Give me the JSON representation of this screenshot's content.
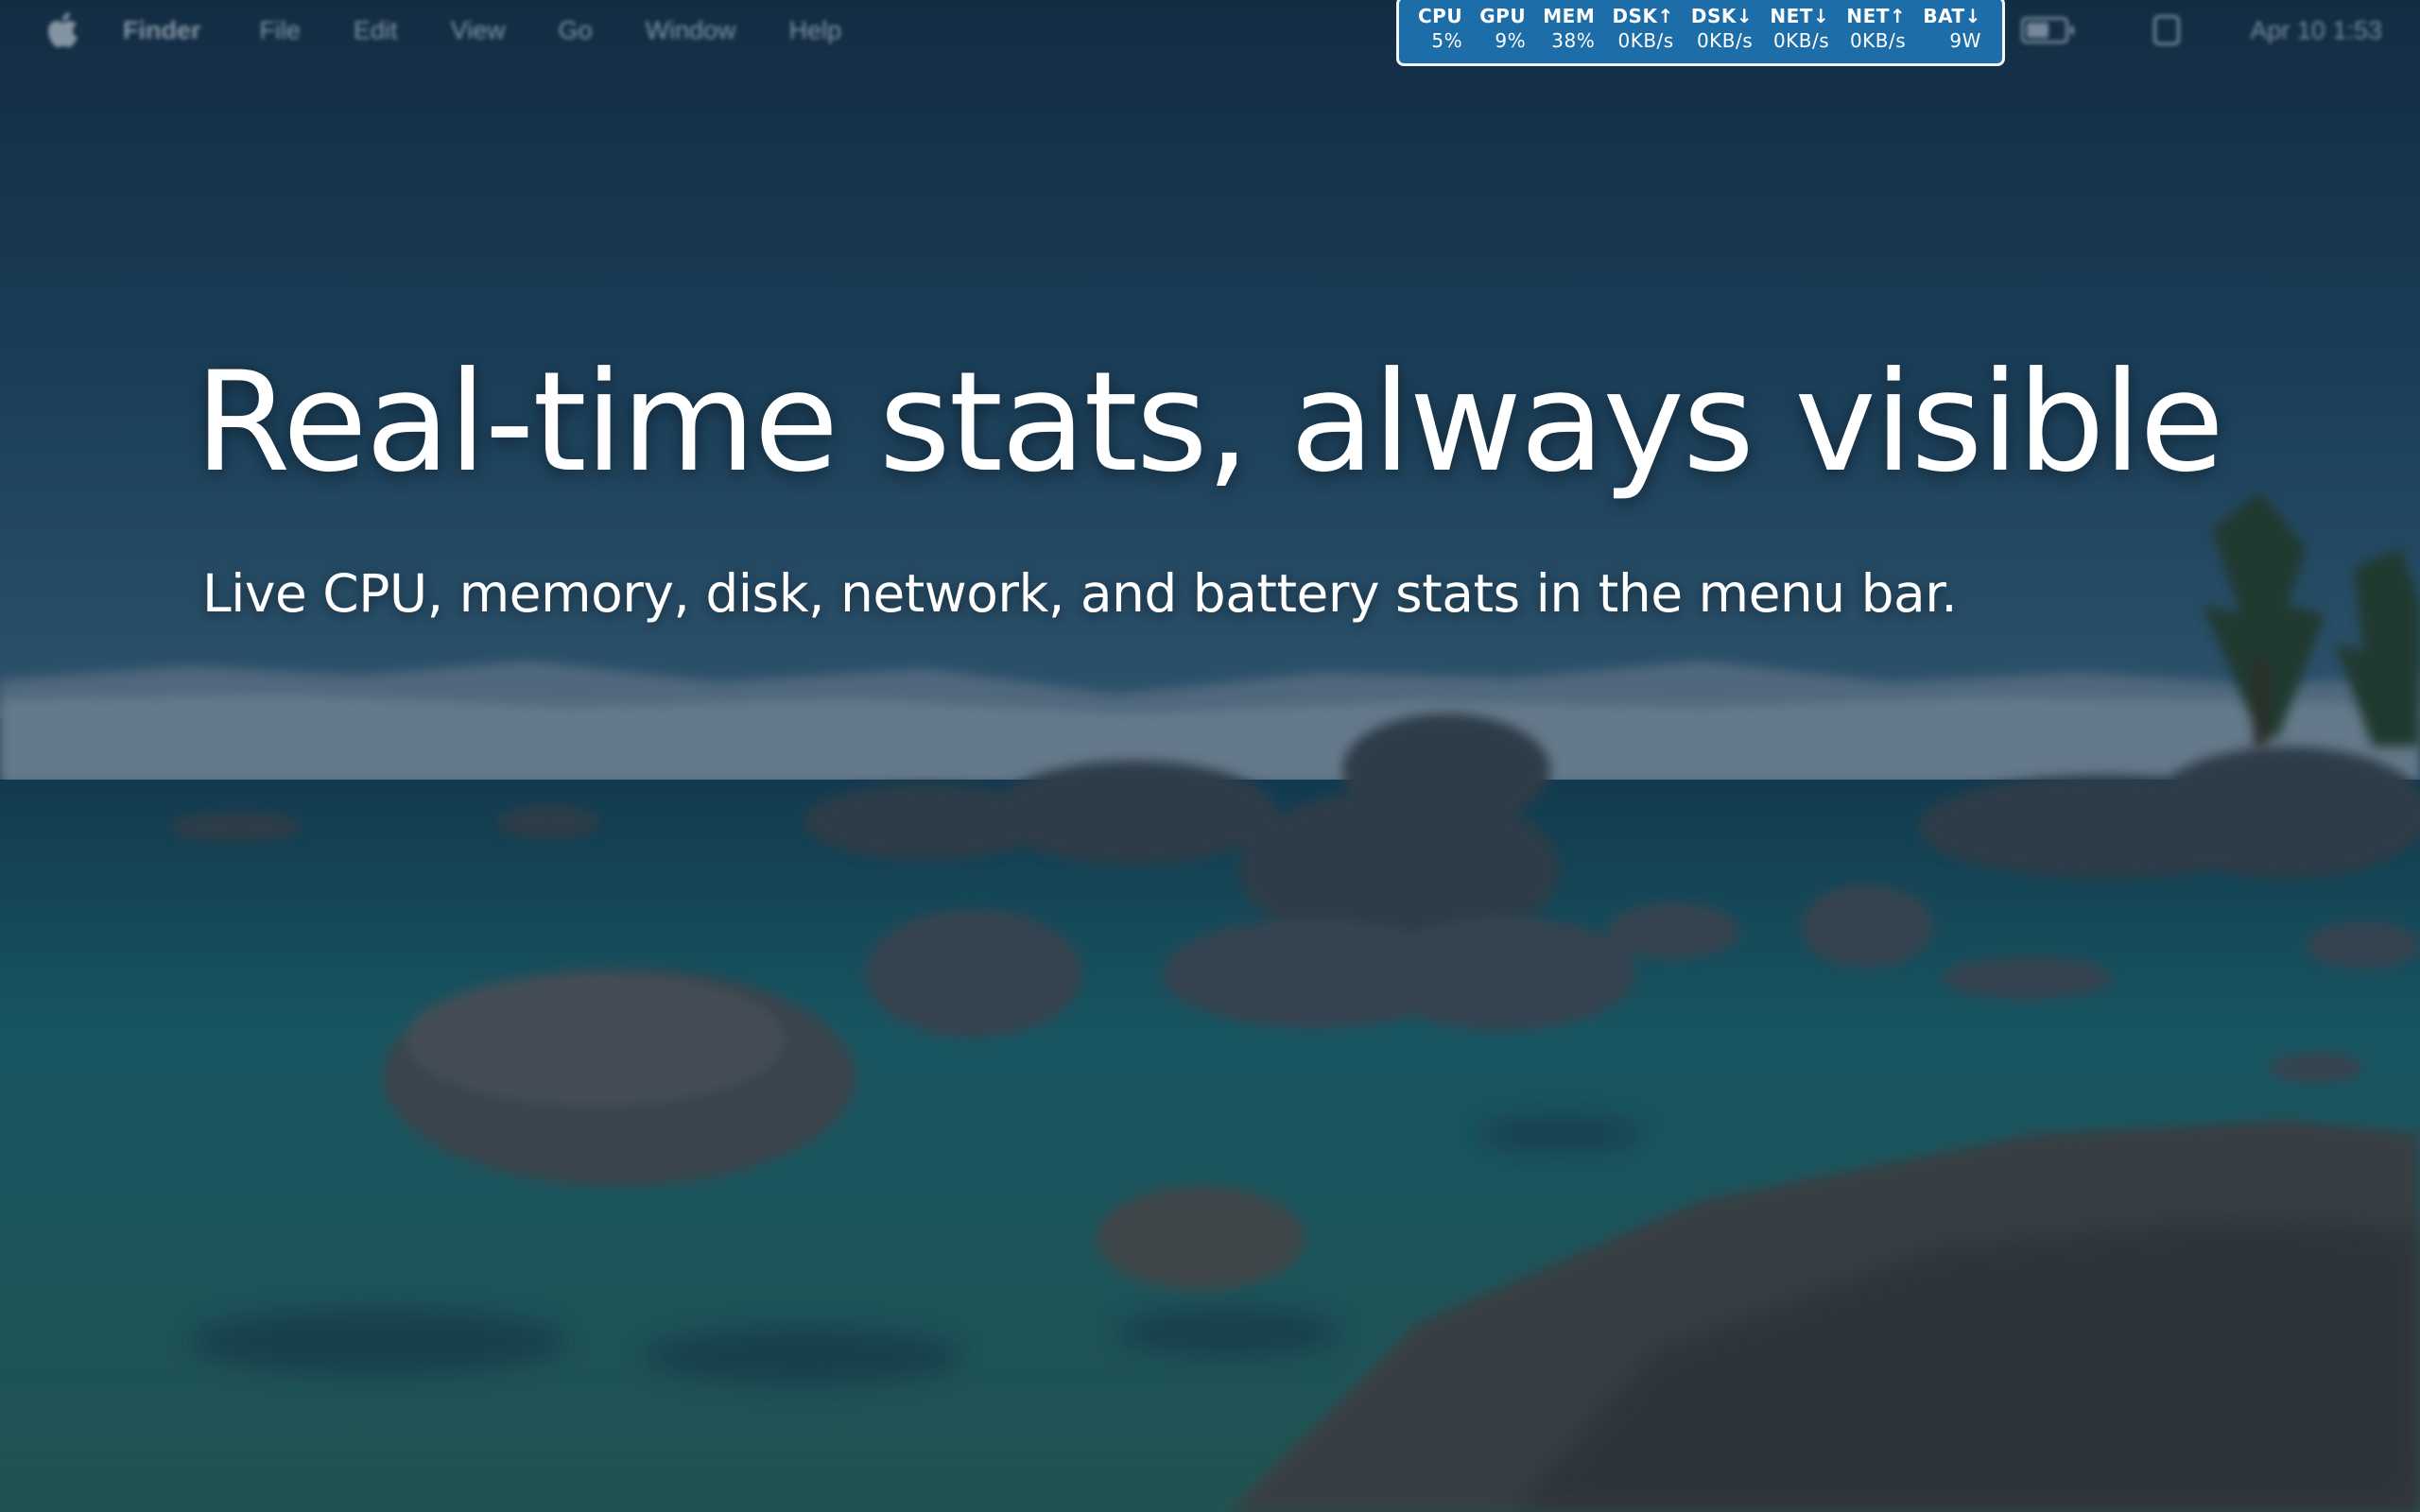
{
  "menubar": {
    "apple_icon": "apple-logo-icon",
    "app_name": "Finder",
    "menus": [
      "File",
      "Edit",
      "View",
      "Go",
      "Window",
      "Help"
    ],
    "clock": "Apr 10  1:53",
    "battery_level": 0.6
  },
  "stats": [
    {
      "label": "CPU",
      "value": "5%"
    },
    {
      "label": "GPU",
      "value": "9%"
    },
    {
      "label": "MEM",
      "value": "38%"
    },
    {
      "label": "DSK↑",
      "value": "0KB/s"
    },
    {
      "label": "DSK↓",
      "value": "0KB/s"
    },
    {
      "label": "NET↓",
      "value": "0KB/s"
    },
    {
      "label": "NET↑",
      "value": "0KB/s"
    },
    {
      "label": "BAT↓",
      "value": "9W"
    }
  ],
  "hero": {
    "headline": "Real-time stats, always visible",
    "subhead": "Live CPU, memory, disk, network, and battery stats in the menu bar."
  },
  "colors": {
    "widget_bg": "#1d6da8",
    "widget_border": "#f2f6fa",
    "sky_top": "#17344d",
    "water": "#1f6f78"
  }
}
